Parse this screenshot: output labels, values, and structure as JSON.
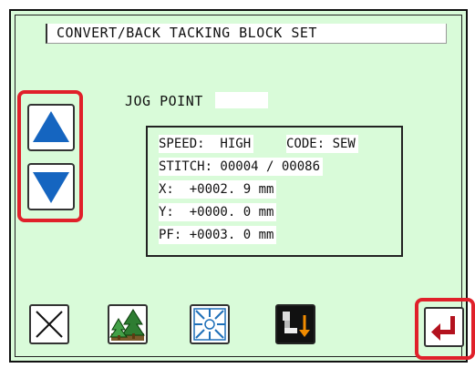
{
  "title": "CONVERT/BACK TACKING BLOCK SET",
  "jog": {
    "label": "JOG POINT"
  },
  "info": {
    "speed": "SPEED:  HIGH",
    "code": "CODE: SEW",
    "stitch": "STITCH: 00004 / 00086",
    "x": "X:  +0002. 9 mm",
    "y": "Y:  +0000. 0 mm",
    "pf": "PF: +0003. 0 mm"
  },
  "icons": {
    "up": "triangle-up-icon",
    "down": "triangle-down-icon",
    "cancel": "close-icon",
    "trees": "trees-icon",
    "converge": "converge-arrows-icon",
    "presser": "presser-foot-icon",
    "enter": "enter-icon"
  },
  "colors": {
    "screen_bg": "#d9fbd9",
    "highlight": "#e0202a",
    "arrow_blue": "#1565c0",
    "enter_red": "#b3121e"
  }
}
